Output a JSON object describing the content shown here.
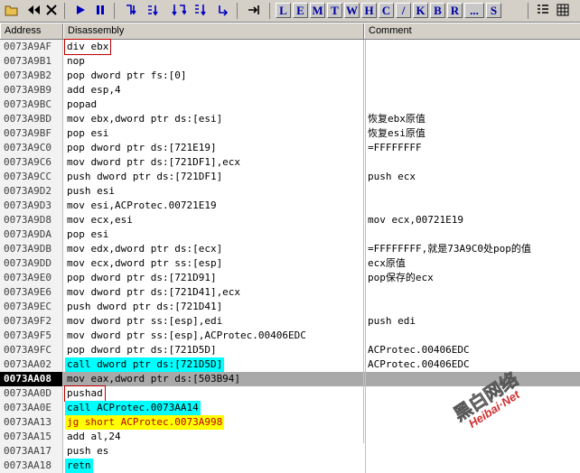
{
  "toolbar": {
    "letters": [
      "L",
      "E",
      "M",
      "T",
      "W",
      "H",
      "C",
      "/",
      "K",
      "B",
      "R",
      "...",
      "S"
    ]
  },
  "columns": {
    "address": "Address",
    "disassembly": "Disassembly",
    "comment": "Comment"
  },
  "rows": [
    {
      "addr": "0073A9AF",
      "dis": "div ebx",
      "cmt": ""
    },
    {
      "addr": "0073A9B1",
      "dis": "nop",
      "cmt": ""
    },
    {
      "addr": "0073A9B2",
      "dis": "pop dword ptr fs:[0]",
      "cmt": ""
    },
    {
      "addr": "0073A9B9",
      "dis": "add esp,4",
      "cmt": ""
    },
    {
      "addr": "0073A9BC",
      "dis": "popad",
      "cmt": ""
    },
    {
      "addr": "0073A9BD",
      "dis": "mov ebx,dword ptr ds:[esi]",
      "cmt": "恢复ebx原值"
    },
    {
      "addr": "0073A9BF",
      "dis": "pop esi",
      "cmt": "恢复esi原值"
    },
    {
      "addr": "0073A9C0",
      "dis": "pop dword ptr ds:[721E19]",
      "cmt": "=FFFFFFFF"
    },
    {
      "addr": "0073A9C6",
      "dis": "mov dword ptr ds:[721DF1],ecx",
      "cmt": ""
    },
    {
      "addr": "0073A9CC",
      "dis": "push dword ptr ds:[721DF1]",
      "cmt": "push ecx"
    },
    {
      "addr": "0073A9D2",
      "dis": "push esi",
      "cmt": ""
    },
    {
      "addr": "0073A9D3",
      "dis": "mov esi,ACProtec.00721E19",
      "cmt": ""
    },
    {
      "addr": "0073A9D8",
      "dis": "mov ecx,esi",
      "cmt": "mov ecx,00721E19"
    },
    {
      "addr": "0073A9DA",
      "dis": "pop esi",
      "cmt": ""
    },
    {
      "addr": "0073A9DB",
      "dis": "mov edx,dword ptr ds:[ecx]",
      "cmt": "=FFFFFFFF,就是73A9C0处pop的值"
    },
    {
      "addr": "0073A9DD",
      "dis": "mov ecx,dword ptr ss:[esp]",
      "cmt": "ecx原值"
    },
    {
      "addr": "0073A9E0",
      "dis": "pop dword ptr ds:[721D91]",
      "cmt": "pop保存的ecx"
    },
    {
      "addr": "0073A9E6",
      "dis": "mov dword ptr ds:[721D41],ecx",
      "cmt": ""
    },
    {
      "addr": "0073A9EC",
      "dis": "push dword ptr ds:[721D41]",
      "cmt": ""
    },
    {
      "addr": "0073A9F2",
      "dis": "mov dword ptr ss:[esp],edi",
      "cmt": "push edi"
    },
    {
      "addr": "0073A9F5",
      "dis": "mov dword ptr ss:[esp],ACProtec.00406EDC",
      "cmt": ""
    },
    {
      "addr": "0073A9FC",
      "dis": "pop dword ptr ds:[721D5D]",
      "cmt": "ACProtec.00406EDC"
    },
    {
      "addr": "0073AA02",
      "dis": "call dword ptr ds:[721D5D]",
      "cmt": "ACProtec.00406EDC"
    },
    {
      "addr": "0073AA08",
      "dis": "mov eax,dword ptr ds:[503B94]",
      "cmt": ""
    },
    {
      "addr": "0073AA0D",
      "dis": "pushad",
      "cmt": ""
    },
    {
      "addr": "0073AA0E",
      "dis": "call ACProtec.0073AA14",
      "cmt": ""
    },
    {
      "addr": "0073AA13",
      "dis": "jg short ACProtec.0073A998",
      "cmt": ""
    },
    {
      "addr": "0073AA15",
      "dis": "add al,24",
      "cmt": ""
    },
    {
      "addr": "0073AA17",
      "dis": "push es",
      "cmt": ""
    },
    {
      "addr": "0073AA18",
      "dis": "retn",
      "cmt": ""
    }
  ],
  "watermark": {
    "cn": "黑白网络",
    "en": "Heibai·Net"
  },
  "colors": {
    "cyan": "#00ffff",
    "yellow": "#ffff00",
    "selected_bg": "#a9a9a9",
    "box": "#c00000"
  }
}
